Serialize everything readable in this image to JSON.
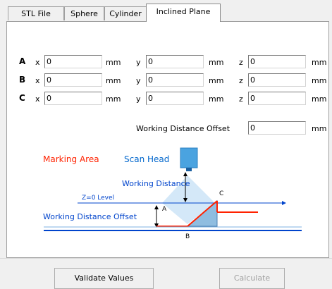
{
  "tabs": [
    "STL File",
    "Sphere",
    "Cylinder",
    "Inclined Plane"
  ],
  "rows": [
    {
      "label": "A",
      "x": "0",
      "y": "0",
      "z": "0"
    },
    {
      "label": "B",
      "x": "0",
      "y": "0",
      "z": "0"
    },
    {
      "label": "C",
      "x": "0",
      "y": "0",
      "z": "0"
    }
  ],
  "axis_labels": {
    "x": "x",
    "y": "y",
    "z": "z"
  },
  "unit": "mm",
  "offset": {
    "label": "Working Distance Offset",
    "value": "0",
    "unit": "mm"
  },
  "diagram": {
    "marking_area": "Marking Area",
    "scan_head": "Scan Head",
    "working_distance": "Working Distance",
    "z0_level": "Z=0 Level",
    "working_distance_offset": "Working Distance Offset",
    "point_a": "A",
    "point_b": "B",
    "point_c": "C",
    "colors": {
      "marking": "#ff2200",
      "scan_head": "#0066cc",
      "line": "#0044cc",
      "head_fill": "#4aa3e0"
    }
  },
  "buttons": {
    "validate": "Validate Values",
    "calculate": "Calculate"
  }
}
